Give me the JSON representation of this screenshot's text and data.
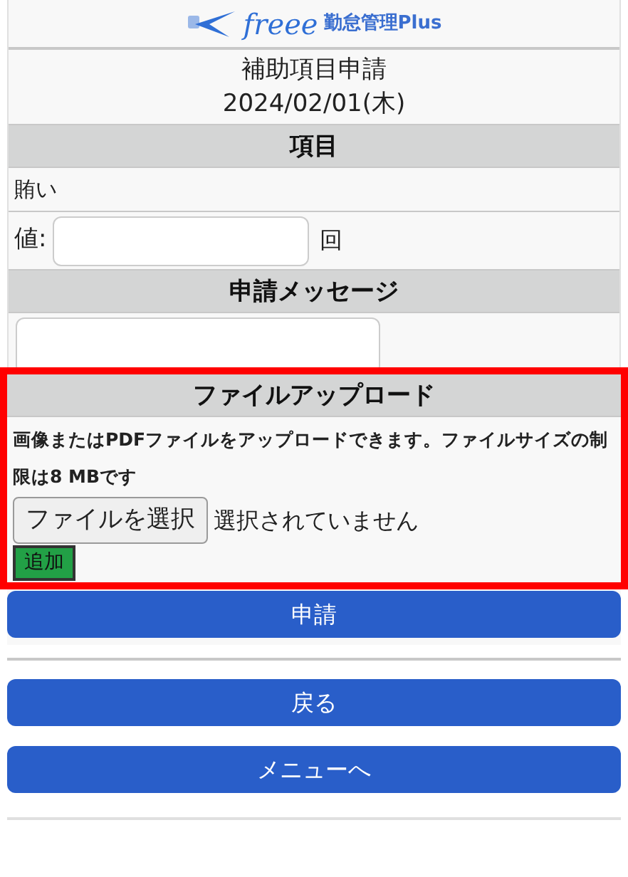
{
  "header": {
    "logo_word": "freee",
    "product": "勤怠管理Plus"
  },
  "title": {
    "heading": "補助項目申請",
    "date": "2024/02/01(木)"
  },
  "item_section": {
    "heading": "項目",
    "item_name": "賄い",
    "value_label": "値:",
    "unit": "回"
  },
  "message_section": {
    "heading": "申請メッセージ"
  },
  "upload_section": {
    "highlighted": true,
    "heading": "ファイルアップロード",
    "note": "画像またはPDFファイルをアップロードできます。ファイルサイズの制限は8 MBです",
    "choose_button": "ファイルを選択",
    "file_status": "選択されていません",
    "add_button": "追加"
  },
  "submit_button": "申請",
  "nav_buttons": [
    "戻る",
    "メニューへ"
  ]
}
